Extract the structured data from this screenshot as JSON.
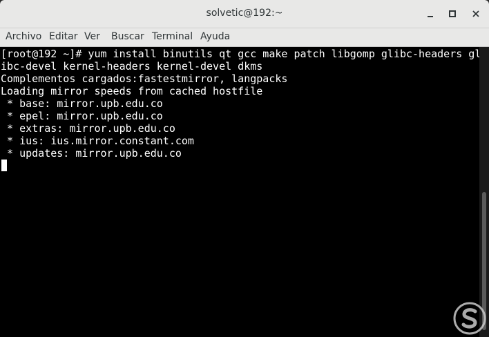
{
  "window": {
    "title": "solvetic@192:~"
  },
  "menubar": {
    "items": [
      "Archivo",
      "Editar",
      "Ver",
      "Buscar",
      "Terminal",
      "Ayuda"
    ]
  },
  "terminal": {
    "lines": [
      "[root@192 ~]# yum install binutils qt gcc make patch libgomp glibc-headers gl",
      "ibc-devel kernel-headers kernel-devel dkms",
      "Complementos cargados:fastestmirror, langpacks",
      "Loading mirror speeds from cached hostfile",
      " * base: mirror.upb.edu.co",
      " * epel: mirror.upb.edu.co",
      " * extras: mirror.upb.edu.co",
      " * ius: ius.mirror.constant.com",
      " * updates: mirror.upb.edu.co"
    ]
  },
  "icons": {
    "minimize": "minimize-icon",
    "maximize": "maximize-icon",
    "close": "close-icon",
    "watermark": "solvetic-logo-icon"
  },
  "colors": {
    "terminal_bg": "#000000",
    "terminal_fg": "#ffffff",
    "chrome_bg": "#e8e8e7",
    "watermark": "#c9c9c9"
  }
}
